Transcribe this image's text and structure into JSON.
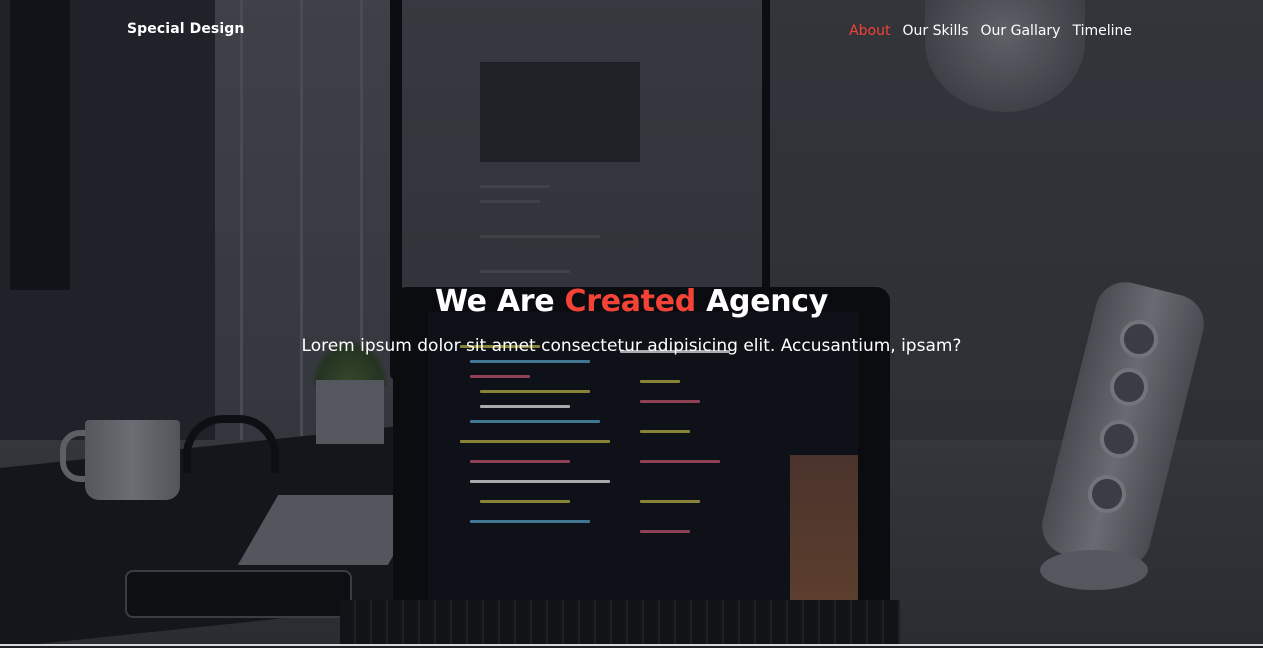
{
  "colors": {
    "accent": "#f44336",
    "text": "#ffffff"
  },
  "header": {
    "logo": "Special Design",
    "nav": [
      {
        "label": "About",
        "active": true
      },
      {
        "label": "Our Skills",
        "active": false
      },
      {
        "label": "Our Gallary",
        "active": false
      },
      {
        "label": "Timeline",
        "active": false
      }
    ]
  },
  "hero": {
    "title_part1": "We Are ",
    "title_accent": "Created",
    "title_part2": " Agency",
    "subtitle": "Lorem ipsum dolor sit amet consectetur adipisicing elit. Accusantium, ipsam?"
  }
}
